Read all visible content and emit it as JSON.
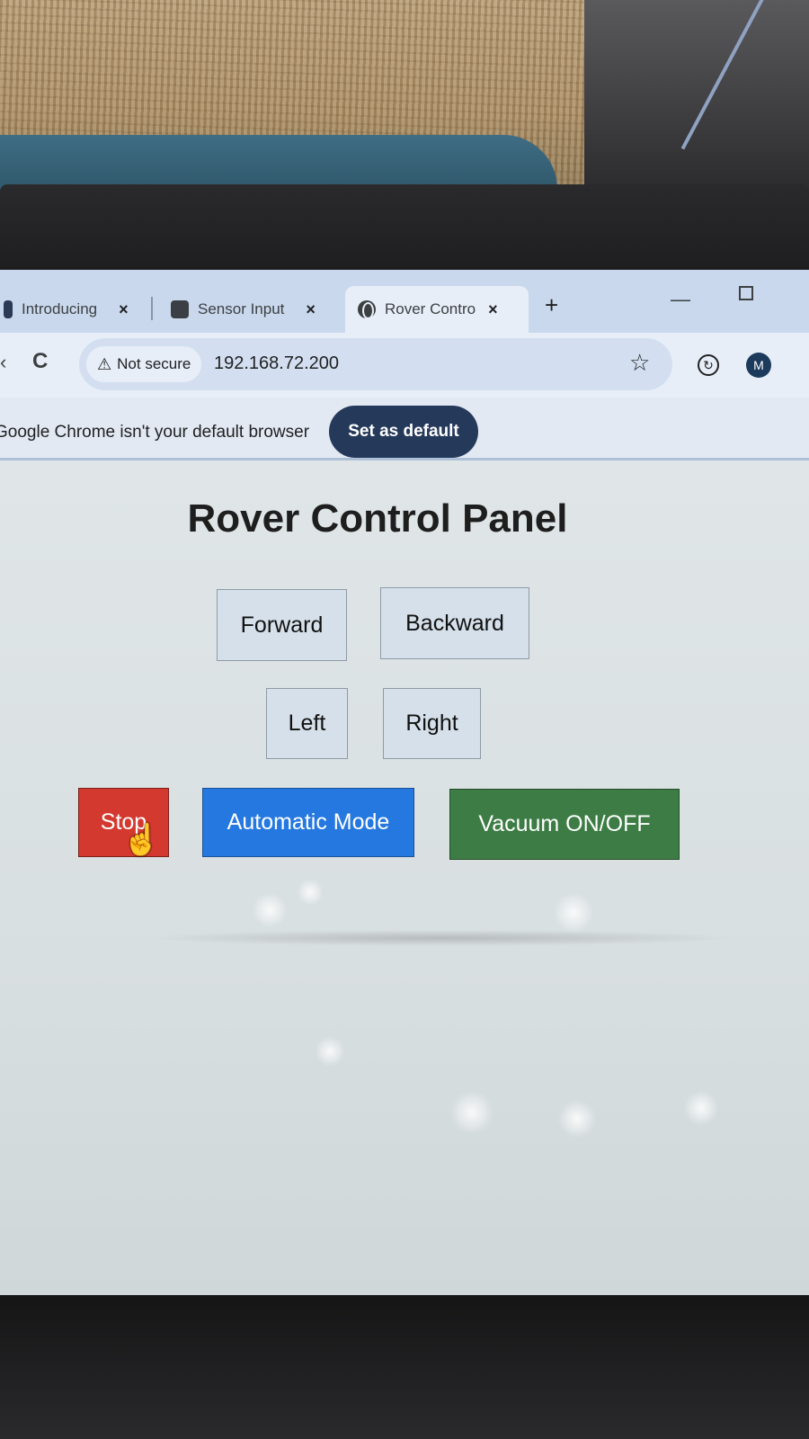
{
  "browser": {
    "tabs": [
      {
        "label": "Introducing",
        "close": "×"
      },
      {
        "label": "Sensor Input",
        "close": "×"
      },
      {
        "label": "Rover Contro",
        "close": "×"
      }
    ],
    "new_tab": "+",
    "window": {
      "minimize": "—"
    },
    "toolbar": {
      "back": "‹",
      "reload": "C",
      "security_label": "Not secure",
      "url": "192.168.72.200",
      "profile_initial": "M"
    },
    "infobar": {
      "message": "Google Chrome isn't your default browser",
      "button": "Set as default"
    }
  },
  "page": {
    "title": "Rover Control Panel",
    "buttons": {
      "forward": "Forward",
      "backward": "Backward",
      "left": "Left",
      "right": "Right",
      "stop": "Stop",
      "auto": "Automatic Mode",
      "vacuum": "Vacuum ON/OFF"
    }
  },
  "colors": {
    "stop": "#d4392f",
    "auto": "#2478e0",
    "vacuum": "#3d7d45",
    "nav_button": "#d5e0ea",
    "set_default": "#25395a"
  }
}
